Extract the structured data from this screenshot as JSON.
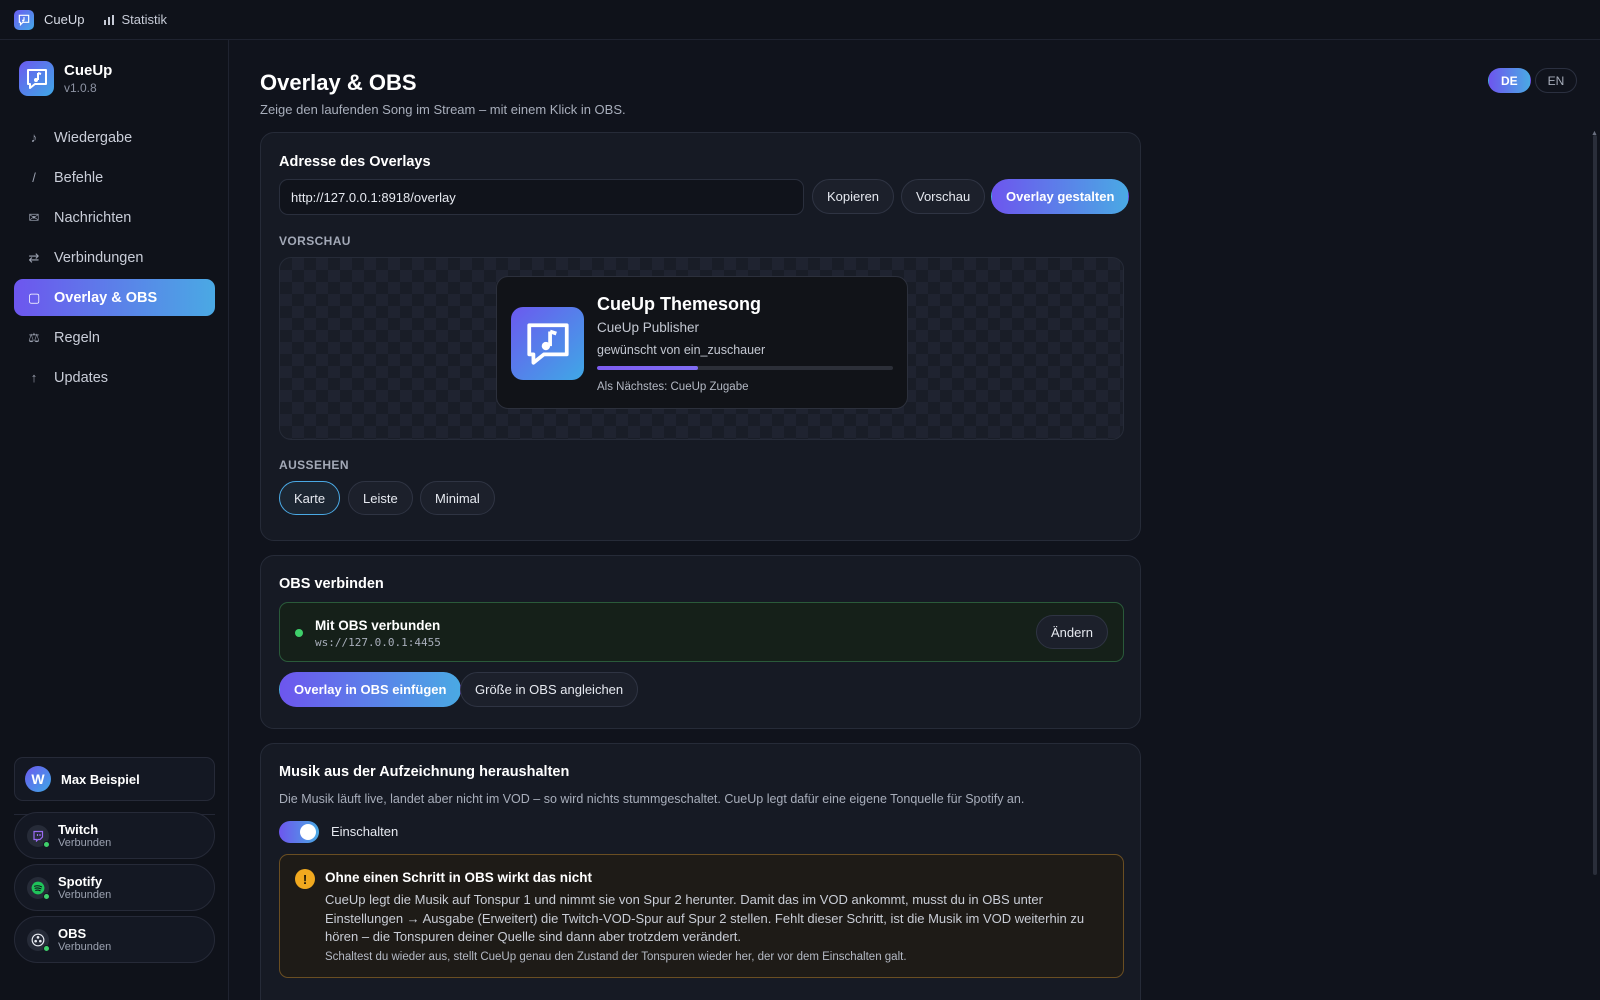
{
  "topbar": {
    "app": "CueUp",
    "stats": "Statistik"
  },
  "sidebar": {
    "app_name": "CueUp",
    "version": "v1.0.8",
    "items": [
      {
        "label": "Wiedergabe",
        "icon": "♪"
      },
      {
        "label": "Befehle",
        "icon": "/"
      },
      {
        "label": "Nachrichten",
        "icon": "✉"
      },
      {
        "label": "Verbindungen",
        "icon": "⇄"
      },
      {
        "label": "Overlay & OBS",
        "icon": "▢"
      },
      {
        "label": "Regeln",
        "icon": "⚖"
      },
      {
        "label": "Updates",
        "icon": "↑"
      }
    ],
    "active_index": 4,
    "user": {
      "name": "Max Beispiel",
      "initial": "W"
    },
    "connections": [
      {
        "name": "Twitch",
        "status": "Verbunden"
      },
      {
        "name": "Spotify",
        "status": "Verbunden"
      },
      {
        "name": "OBS",
        "status": "Verbunden"
      }
    ]
  },
  "header": {
    "title": "Overlay & OBS",
    "subtitle": "Zeige den laufenden Song im Stream – mit einem Klick in OBS.",
    "languages": [
      "DE",
      "EN"
    ],
    "active_language": "DE"
  },
  "overlay": {
    "title": "Adresse des Overlays",
    "url": "http://127.0.0.1:8918/overlay",
    "copy": "Kopieren",
    "preview_btn": "Vorschau",
    "design_btn": "Overlay gestalten",
    "preview_label": "VORSCHAU",
    "preview": {
      "song": "CueUp Themesong",
      "artist": "CueUp Publisher",
      "requested": "gewünscht von ein_zuschauer",
      "progress": 0.34,
      "next": "Als Nächstes: CueUp Zugabe"
    },
    "appearance_label": "AUSSEHEN",
    "styles": [
      "Karte",
      "Leiste",
      "Minimal"
    ],
    "selected_style": "Karte"
  },
  "obs": {
    "title": "OBS verbinden",
    "status_title": "Mit OBS verbunden",
    "status_url": "ws://127.0.0.1:4455",
    "change": "Ändern",
    "insert": "Overlay in OBS einfügen",
    "resize": "Größe in OBS angleichen"
  },
  "vod": {
    "title": "Musik aus der Aufzeichnung heraushalten",
    "description": "Die Musik läuft live, landet aber nicht im VOD – so wird nichts stummgeschaltet. CueUp legt dafür eine eigene Tonquelle für Spotify an.",
    "toggle_label": "Einschalten",
    "enabled": true,
    "warning_title": "Ohne einen Schritt in OBS wirkt das nicht",
    "warning_body": "CueUp legt die Musik auf Tonspur 1 und nimmt sie von Spur 2 herunter. Damit das im VOD ankommt, musst du in OBS unter Einstellungen → Ausgabe (Erweitert) die Twitch-VOD-Spur auf Spur 2 stellen. Fehlt dieser Schritt, ist die Musik im VOD weiterhin zu hören – die Tonspuren deiner Quelle sind dann aber trotzdem verändert.",
    "warning_foot": "Schaltest du wieder aus, stellt CueUp genau den Zustand der Tonspuren wieder her, der vor dem Einschalten galt."
  },
  "colors": {
    "accent_start": "#6d56ee",
    "accent_end": "#4aa9e4",
    "success": "#3fd06b",
    "warning": "#f1a91f"
  }
}
